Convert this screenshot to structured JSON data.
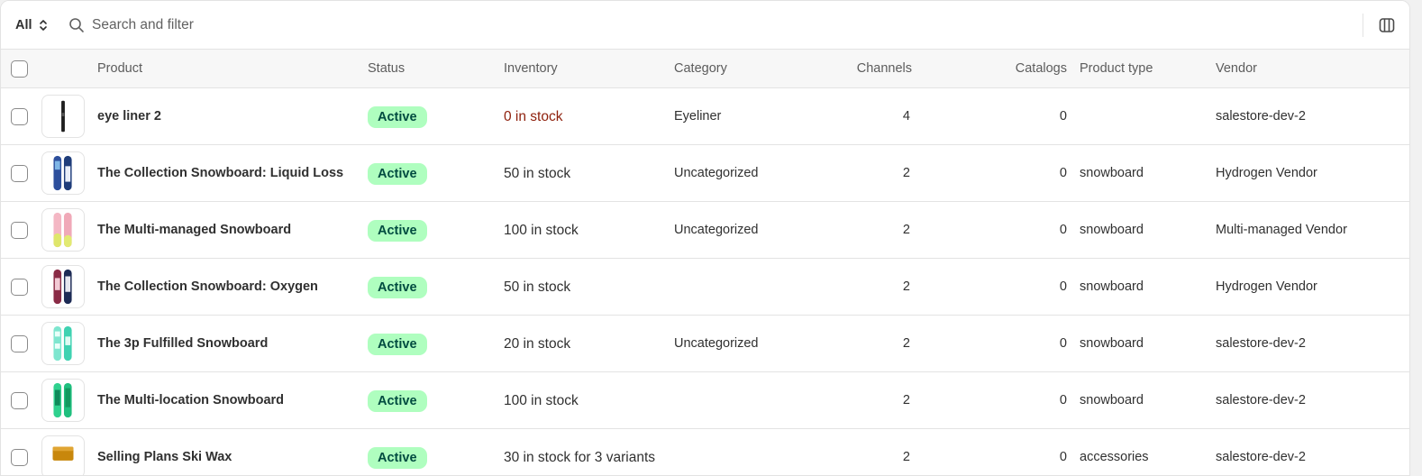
{
  "toolbar": {
    "view_label": "All",
    "search_placeholder": "Search and filter"
  },
  "columns": {
    "product": "Product",
    "status": "Status",
    "inventory": "Inventory",
    "category": "Category",
    "channels": "Channels",
    "catalogs": "Catalogs",
    "product_type": "Product type",
    "vendor": "Vendor"
  },
  "colors": {
    "active_badge_bg": "#affebf",
    "active_badge_text": "#014b40",
    "zero_stock_text": "#8e1f0b"
  },
  "rows": [
    {
      "product": "eye liner 2",
      "status": "Active",
      "inventory": "0 in stock",
      "category": "Eyeliner",
      "channels": "4",
      "catalogs": "0",
      "product_type": "",
      "vendor": "salestore-dev-2",
      "thumb": "eyeliner"
    },
    {
      "product": "The Collection Snowboard: Liquid Loss",
      "status": "Active",
      "inventory": "50 in stock",
      "category": "Uncategorized",
      "channels": "2",
      "catalogs": "0",
      "product_type": "snowboard",
      "vendor": "Hydrogen Vendor",
      "thumb": "snowboard-blue"
    },
    {
      "product": "The Multi-managed Snowboard",
      "status": "Active",
      "inventory": "100 in stock",
      "category": "Uncategorized",
      "channels": "2",
      "catalogs": "0",
      "product_type": "snowboard",
      "vendor": "Multi-managed Vendor",
      "thumb": "snowboard-pink-yellow"
    },
    {
      "product": "The Collection Snowboard: Oxygen",
      "status": "Active",
      "inventory": "50 in stock",
      "category": "",
      "channels": "2",
      "catalogs": "0",
      "product_type": "snowboard",
      "vendor": "Hydrogen Vendor",
      "thumb": "snowboard-maroon-navy"
    },
    {
      "product": "The 3p Fulfilled Snowboard",
      "status": "Active",
      "inventory": "20 in stock",
      "category": "Uncategorized",
      "channels": "2",
      "catalogs": "0",
      "product_type": "snowboard",
      "vendor": "salestore-dev-2",
      "thumb": "snowboard-aqua"
    },
    {
      "product": "The Multi-location Snowboard",
      "status": "Active",
      "inventory": "100 in stock",
      "category": "",
      "channels": "2",
      "catalogs": "0",
      "product_type": "snowboard",
      "vendor": "salestore-dev-2",
      "thumb": "snowboard-green"
    },
    {
      "product": "Selling Plans Ski Wax",
      "status": "Active",
      "inventory": "30 in stock for 3 variants",
      "category": "",
      "channels": "2",
      "catalogs": "0",
      "product_type": "accessories",
      "vendor": "salestore-dev-2",
      "thumb": "ski-wax"
    }
  ]
}
